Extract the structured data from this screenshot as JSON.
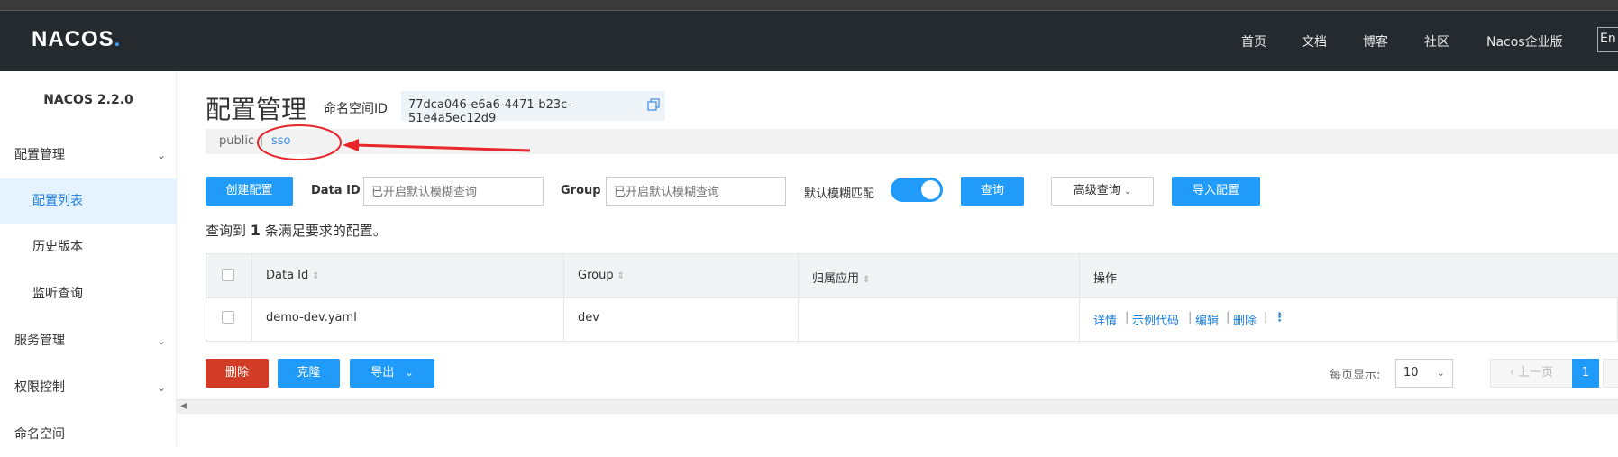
{
  "header": {
    "logo_text": "NACOS",
    "logo_dot": ".",
    "nav": [
      "首页",
      "文档",
      "博客",
      "社区",
      "Nacos企业版"
    ],
    "lang_button": "En"
  },
  "sidebar": {
    "version": "NACOS 2.2.0",
    "groups": [
      {
        "label": "配置管理"
      },
      {
        "label": "服务管理"
      },
      {
        "label": "权限控制"
      },
      {
        "label": "命名空间"
      }
    ],
    "config_items": [
      {
        "label": "配置列表",
        "active": true
      },
      {
        "label": "历史版本"
      },
      {
        "label": "监听查询"
      }
    ]
  },
  "main": {
    "title": "配置管理",
    "namespace_label": "命名空间ID",
    "namespace_id": "77dca046-e6a6-4471-b23c-51e4a5ec12d9",
    "namespaces": [
      "public",
      "sso"
    ],
    "namespace_separator": "|",
    "toolbar": {
      "create_button": "创建配置",
      "data_id_label": "Data ID",
      "data_id_placeholder": "已开启默认模糊查询",
      "group_label": "Group",
      "group_placeholder": "已开启默认模糊查询",
      "fuzzy_label": "默认模糊匹配",
      "fuzzy_enabled": true,
      "query_button": "查询",
      "advanced_button": "高级查询",
      "import_button": "导入配置"
    },
    "result": {
      "prefix": "查询到",
      "count": "1",
      "suffix": "条满足要求的配置。"
    },
    "table": {
      "columns": [
        "Data Id",
        "Group",
        "归属应用",
        "操作"
      ],
      "rows": [
        {
          "data_id": "demo-dev.yaml",
          "group": "dev",
          "app": "",
          "actions": [
            "详情",
            "示例代码",
            "编辑",
            "删除"
          ]
        }
      ]
    },
    "footer": {
      "delete_button": "删除",
      "clone_button": "克隆",
      "export_button": "导出",
      "page_size_label": "每页显示:",
      "page_size": "10",
      "prev_button": "上一页",
      "current_page": "1"
    }
  },
  "colors": {
    "primary": "#209bfa",
    "danger": "#d23c26",
    "header_bg": "#252a2f",
    "annotation": "#e8252a"
  }
}
